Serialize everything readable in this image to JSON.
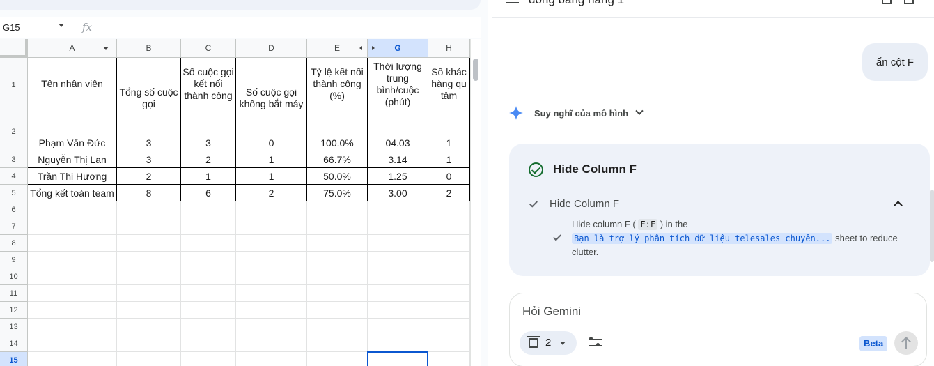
{
  "panel": {
    "title": "đóng băng hàng 1"
  },
  "sheet": {
    "name_box": "G15",
    "fx": "fx",
    "columns": [
      "A",
      "B",
      "C",
      "D",
      "E",
      "G",
      "H"
    ],
    "selected_column": "G",
    "rows": [
      "1",
      "2",
      "3",
      "4",
      "5",
      "6",
      "7",
      "8",
      "9",
      "10",
      "11",
      "12",
      "13",
      "14",
      "15"
    ],
    "selected_row": "15",
    "header": [
      "Tên nhân viên",
      "Tổng số cuộc gọi",
      "Số cuộc gọi kết nối thành công",
      "Số cuộc gọi không bắt máy",
      "Tỷ lệ kết nối thành công (%)",
      "Thời lượng trung bình/cuộc (phút)",
      "Số khác hàng qu tâm"
    ],
    "data": [
      [
        "Phạm Văn Đức",
        "3",
        "3",
        "0",
        "100.0%",
        "04.03",
        "1"
      ],
      [
        "Nguyễn Thị Lan",
        "3",
        "2",
        "1",
        "66.7%",
        "3.14",
        "1"
      ],
      [
        "Trần Thị Hương",
        "2",
        "1",
        "1",
        "50.0%",
        "1.25",
        "0"
      ],
      [
        "Tổng kết toàn team",
        "8",
        "6",
        "2",
        "75.0%",
        "3.00",
        "2"
      ]
    ]
  },
  "chat": {
    "user_message": "ẩn cột F",
    "thinking_label": "Suy nghĩ của mô hình",
    "action_title": "Hide Column F",
    "step_title": "Hide Column F",
    "detail_prefix": "Hide column F (",
    "detail_range": "F:F",
    "detail_mid": ") in the",
    "detail_sheet": "Bạn là trợ lý phân tích dữ liệu telesales chuyên...",
    "detail_suffix": "sheet to reduce clutter.",
    "input_placeholder": "Hỏi Gemini",
    "tool_count": "2",
    "beta": "Beta"
  }
}
